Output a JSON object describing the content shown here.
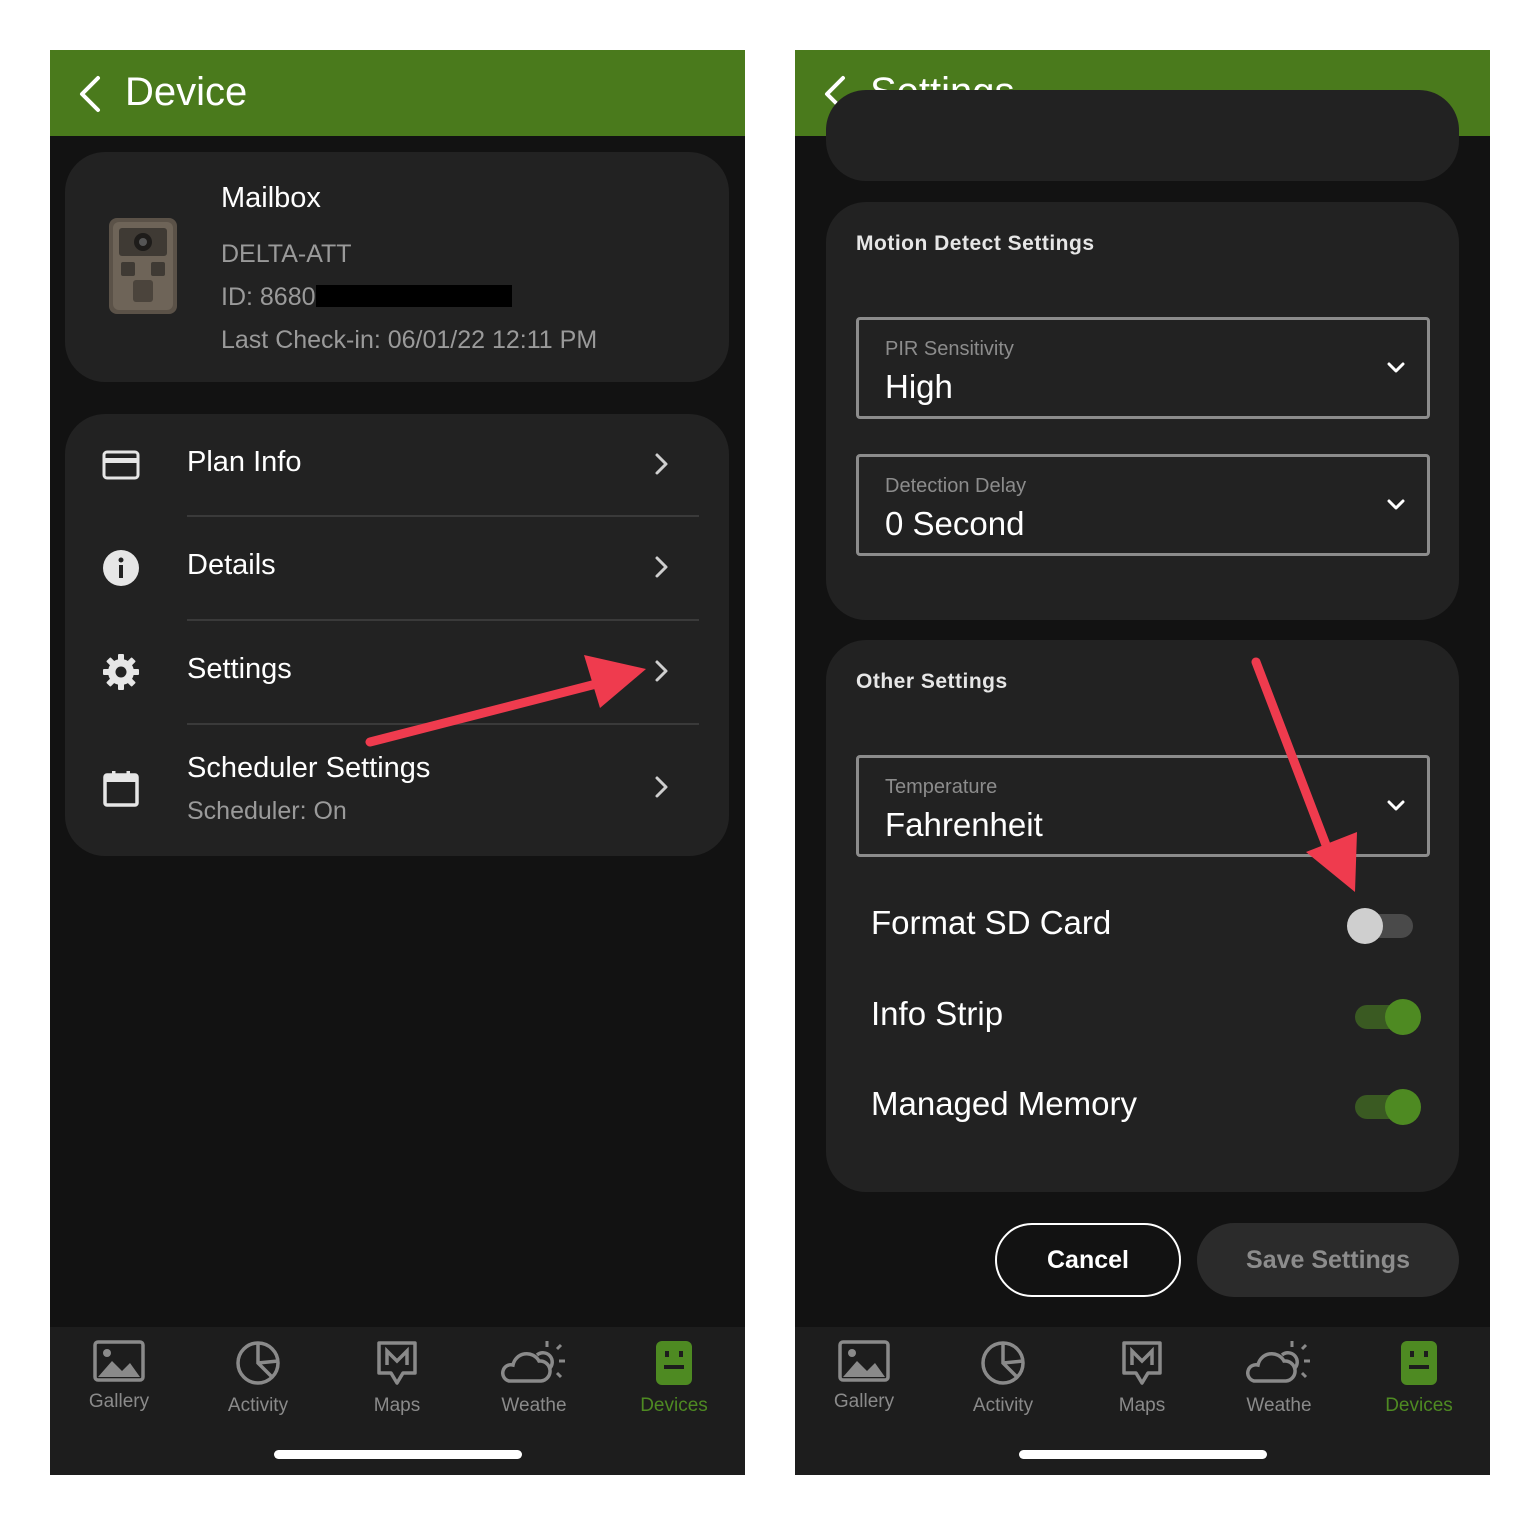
{
  "colors": {
    "header_green": "#4a7a1c",
    "accent_green": "#4e8a22",
    "annotation_red": "#ef3b4e"
  },
  "left": {
    "header": {
      "title": "Device",
      "back_icon": "chevron-left-icon"
    },
    "device": {
      "name": "Mailbox",
      "model": "DELTA-ATT",
      "id": "ID: 8680",
      "last_checkin": "Last Check-in: 06/01/22 12:11 PM"
    },
    "menu": [
      {
        "label": "Plan Info",
        "icon": "credit-card-icon"
      },
      {
        "label": "Details",
        "icon": "info-icon"
      },
      {
        "label": "Settings",
        "icon": "gear-icon"
      },
      {
        "label": "Scheduler Settings",
        "sub": "Scheduler: On",
        "icon": "calendar-icon"
      }
    ]
  },
  "right": {
    "header": {
      "title": "Settings",
      "back_icon": "chevron-left-icon"
    },
    "motion": {
      "title": "Motion Detect Settings",
      "pir": {
        "label": "PIR Sensitivity",
        "value": "High"
      },
      "delay": {
        "label": "Detection Delay",
        "value": "0 Second"
      }
    },
    "other": {
      "title": "Other Settings",
      "temperature": {
        "label": "Temperature",
        "value": "Fahrenheit"
      },
      "toggles": [
        {
          "label": "Format SD Card",
          "on": false
        },
        {
          "label": "Info Strip",
          "on": true
        },
        {
          "label": "Managed Memory",
          "on": true
        }
      ]
    },
    "buttons": {
      "cancel": "Cancel",
      "save": "Save Settings"
    }
  },
  "tabs": [
    {
      "label": "Gallery",
      "icon": "image-icon",
      "active": false
    },
    {
      "label": "Activity",
      "icon": "pie-chart-icon",
      "active": false
    },
    {
      "label": "Maps",
      "icon": "map-icon",
      "active": false
    },
    {
      "label": "Weathe",
      "icon": "weather-icon",
      "active": false
    },
    {
      "label": "Devices",
      "icon": "camera-device-icon",
      "active": true
    }
  ]
}
